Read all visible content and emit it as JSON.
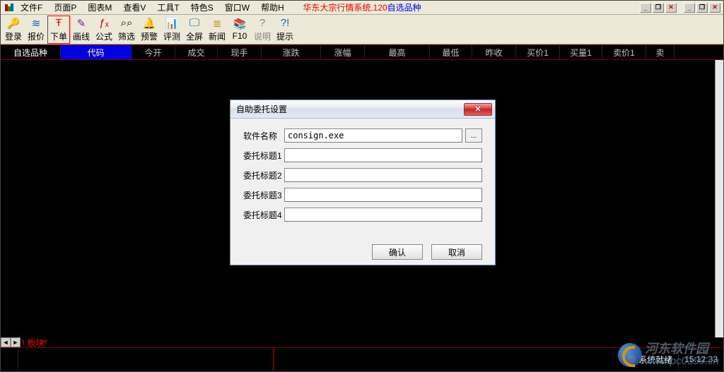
{
  "menubar": {
    "items": [
      "文件F",
      "页面P",
      "图表M",
      "查看V",
      "工具T",
      "特色S",
      "窗口W",
      "帮助H"
    ],
    "title_prefix": "华东大宗行情系统.120",
    "title_suffix": "自选品种"
  },
  "window_buttons": {
    "min": "_",
    "restore": "❐",
    "close": "✕",
    "min2": "_",
    "max2": "❐",
    "close2": "✕"
  },
  "toolbar": [
    {
      "label": "登录",
      "icon_name": "login-icon",
      "glyph": "🔑",
      "color": "#1060c0"
    },
    {
      "label": "报价",
      "icon_name": "quote-icon",
      "glyph": "≋",
      "color": "#1060c0"
    },
    {
      "label": "下单",
      "icon_name": "order-icon",
      "glyph": "Ŧ",
      "color": "#ff0000",
      "selected": true
    },
    {
      "label": "画线",
      "icon_name": "draw-icon",
      "glyph": "✎",
      "color": "#7020c0"
    },
    {
      "label": "公式",
      "icon_name": "formula-icon",
      "glyph": "ƒₓ",
      "color": "#e00000"
    },
    {
      "label": "筛选",
      "icon_name": "filter-icon",
      "glyph": "⌕⌕",
      "color": "#000"
    },
    {
      "label": "预警",
      "icon_name": "alert-icon",
      "glyph": "🔔",
      "color": "#c00000"
    },
    {
      "label": "评测",
      "icon_name": "evaluate-icon",
      "glyph": "📊",
      "color": "#208020"
    },
    {
      "label": "全屏",
      "icon_name": "fullscreen-icon",
      "glyph": "🖵",
      "color": "#1060c0"
    },
    {
      "label": "新闻",
      "icon_name": "news-icon",
      "glyph": "≣",
      "color": "#c08000"
    },
    {
      "label": "F10",
      "icon_name": "f10-icon",
      "glyph": "📚",
      "color": "#a04000"
    },
    {
      "label": "说明",
      "icon_name": "help-icon",
      "glyph": "?",
      "color": "#808080",
      "nolabel": true
    },
    {
      "label": "提示",
      "icon_name": "tip-icon",
      "glyph": "?!",
      "color": "#1060c0"
    }
  ],
  "columns": [
    {
      "label": "自选品种",
      "width": 85,
      "cls": "first"
    },
    {
      "label": "代码",
      "width": 100,
      "cls": "code"
    },
    {
      "label": "今开",
      "width": 62
    },
    {
      "label": "成交",
      "width": 60
    },
    {
      "label": "现手",
      "width": 62
    },
    {
      "label": "涨跌",
      "width": 84
    },
    {
      "label": "涨幅",
      "width": 62
    },
    {
      "label": "最高",
      "width": 92
    },
    {
      "label": "最低",
      "width": 60
    },
    {
      "label": "昨收",
      "width": 62
    },
    {
      "label": "买价1",
      "width": 62
    },
    {
      "label": "买量1",
      "width": 60
    },
    {
      "label": "卖价1",
      "width": 62
    },
    {
      "label": "卖",
      "width": 40
    }
  ],
  "tab": {
    "label": "板块"
  },
  "status": {
    "ready": "系统就绪",
    "time": "15:12:33"
  },
  "dialog": {
    "title": "自助委托设置",
    "fields": {
      "software_label": "软件名称",
      "software_value": "consign.exe",
      "t1_label": "委托标题1",
      "t1_value": "",
      "t2_label": "委托标题2",
      "t2_value": "",
      "t3_label": "委托标题3",
      "t3_value": "",
      "t4_label": "委托标题4",
      "t4_value": ""
    },
    "browse": "...",
    "ok": "确认",
    "cancel": "取消"
  },
  "watermark": {
    "cn": "河东软件园",
    "en": "www.pc0359.cn"
  }
}
